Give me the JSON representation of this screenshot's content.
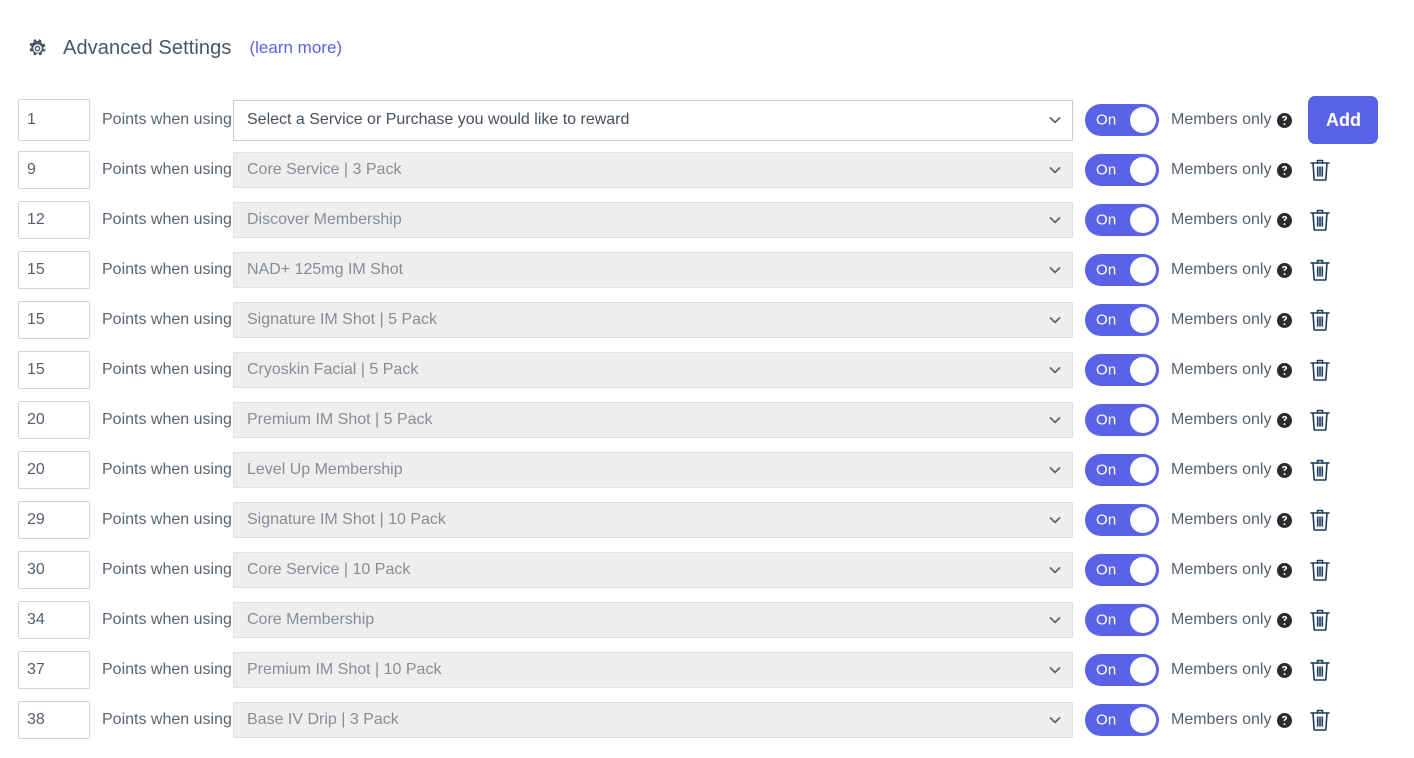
{
  "header": {
    "gear_icon": "gear-icon",
    "title": "Advanced Settings",
    "learn_more": "(learn more)"
  },
  "labels": {
    "points_when_using": "Points when using",
    "members_only": "Members only",
    "toggle_on": "On",
    "add_button": "Add",
    "help_icon": "help-circle-icon",
    "delete_icon": "trash-icon",
    "caret_icon": "chevron-down-icon"
  },
  "rows": [
    {
      "points": "1",
      "service": "Select a Service or Purchase you would like to reward",
      "toggle": "On",
      "members_only": "Members only",
      "action": "Add",
      "primary": true
    },
    {
      "points": "9",
      "service": "Core Service | 3 Pack",
      "toggle": "On",
      "members_only": "Members only",
      "primary": false
    },
    {
      "points": "12",
      "service": "Discover Membership",
      "toggle": "On",
      "members_only": "Members only",
      "primary": false
    },
    {
      "points": "15",
      "service": "NAD+ 125mg IM Shot",
      "toggle": "On",
      "members_only": "Members only",
      "primary": false
    },
    {
      "points": "15",
      "service": "Signature IM Shot | 5 Pack",
      "toggle": "On",
      "members_only": "Members only",
      "primary": false
    },
    {
      "points": "15",
      "service": "Cryoskin Facial | 5 Pack",
      "toggle": "On",
      "members_only": "Members only",
      "primary": false
    },
    {
      "points": "20",
      "service": "Premium IM Shot | 5 Pack",
      "toggle": "On",
      "members_only": "Members only",
      "primary": false
    },
    {
      "points": "20",
      "service": "Level Up Membership",
      "toggle": "On",
      "members_only": "Members only",
      "primary": false
    },
    {
      "points": "29",
      "service": "Signature IM Shot | 10 Pack",
      "toggle": "On",
      "members_only": "Members only",
      "primary": false
    },
    {
      "points": "30",
      "service": "Core Service | 10 Pack",
      "toggle": "On",
      "members_only": "Members only",
      "primary": false
    },
    {
      "points": "34",
      "service": "Core Membership",
      "toggle": "On",
      "members_only": "Members only",
      "primary": false
    },
    {
      "points": "37",
      "service": "Premium IM Shot | 10 Pack",
      "toggle": "On",
      "members_only": "Members only",
      "primary": false
    },
    {
      "points": "38",
      "service": "Base IV Drip | 3 Pack",
      "toggle": "On",
      "members_only": "Members only",
      "primary": false
    }
  ],
  "colors": {
    "accent": "#5a63e8",
    "label_text": "#5a6570",
    "disabled_select_bg": "#eeeeef",
    "disabled_select_text": "#878d94",
    "trash": "#1b3a5c"
  }
}
